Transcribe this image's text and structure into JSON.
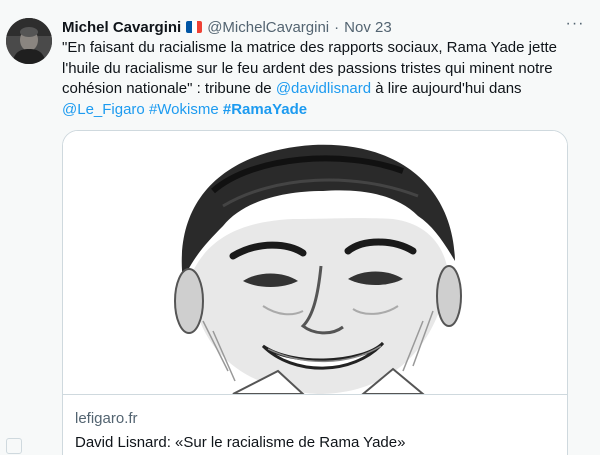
{
  "tweet": {
    "author_name": "Michel Cavargini",
    "handle": "@MichelCavargini",
    "separator": "·",
    "date": "Nov 23",
    "more_label": "···",
    "flag_colors": [
      "#0055a4",
      "#ffffff",
      "#ef4135"
    ],
    "text": {
      "part1": "\"En faisant du racialisme la matrice des rapports sociaux, Rama Yade jette l'huile du racialisme sur le feu ardent des passions tristes qui minent notre cohésion nationale\" : tribune de ",
      "mention1": "@davidlisnard",
      "part2": " à lire aujourd'hui dans ",
      "mention2": "@Le_Figaro",
      "space": " ",
      "hashtag1": "#Wokisme",
      "hashtag2": "#RamaYade"
    },
    "link_color": "#1d9bf0"
  },
  "card": {
    "image_alt": "Pencil sketch portrait of a smiling man",
    "domain": "lefigaro.fr",
    "title": "David Lisnard: «Sur le racialisme de Rama Yade»"
  }
}
